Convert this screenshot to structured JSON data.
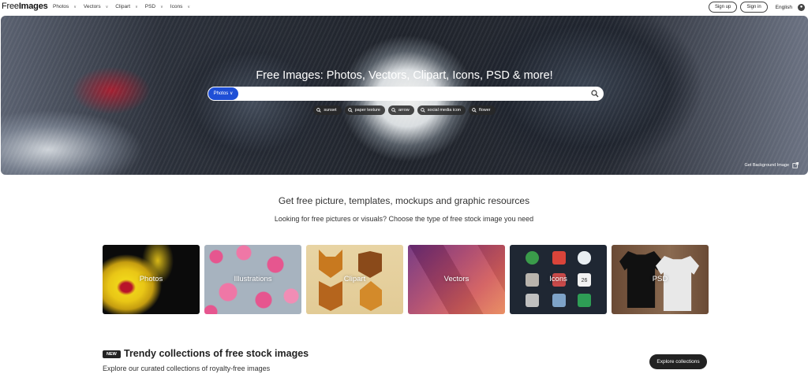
{
  "header": {
    "logo_light": "Free",
    "logo_bold": "Images",
    "nav": [
      {
        "label": "Photos"
      },
      {
        "label": "Vectors"
      },
      {
        "label": "Clipart"
      },
      {
        "label": "PSD"
      },
      {
        "label": "Icons"
      }
    ],
    "signup_label": "Sign up",
    "signin_label": "Sign in",
    "language": "English"
  },
  "hero": {
    "title": "Free Images: Photos, Vectors, Clipart, Icons, PSD & more!",
    "search_type": "Photos",
    "search_placeholder": "",
    "chips": [
      {
        "label": "sunset"
      },
      {
        "label": "paper texture"
      },
      {
        "label": "arrow"
      },
      {
        "label": "social media icon"
      },
      {
        "label": "flower"
      }
    ],
    "get_background": "Get Background Image"
  },
  "intro": {
    "headline": "Get free picture, templates, mockups and graphic resources",
    "subtitle": "Looking for free pictures or visuals? Choose the type of free stock image you need"
  },
  "categories": [
    {
      "label": "Photos"
    },
    {
      "label": "Illustrations"
    },
    {
      "label": "Clipart"
    },
    {
      "label": "Vectors"
    },
    {
      "label": "Icons"
    },
    {
      "label": "PSD"
    }
  ],
  "icons_tile": {
    "calendar_day": "26"
  },
  "trendy": {
    "badge": "NEW",
    "title": "Trendy collections of free stock images",
    "subtitle": "Explore our curated collections of royalty-free images",
    "explore_label": "Explore collections"
  },
  "colors": {
    "search_type_bg": "#1f4fd6",
    "dark_button": "#222222"
  }
}
